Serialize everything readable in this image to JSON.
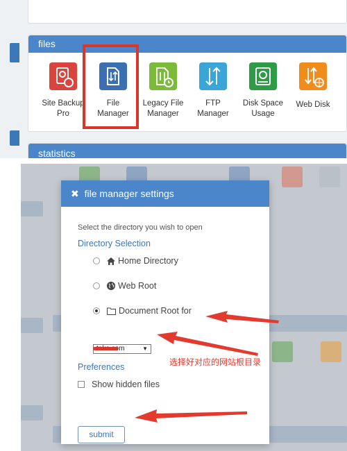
{
  "files_panel": {
    "title": "files",
    "apps": [
      {
        "label_1": "Site Backup",
        "label_2": "Pro",
        "icon": "site-backup-icon",
        "color": "#d9453e"
      },
      {
        "label_1": "File",
        "label_2": "Manager",
        "icon": "file-manager-icon",
        "color": "#3c6fb2"
      },
      {
        "label_1": "Legacy File",
        "label_2": "Manager",
        "icon": "legacy-file-manager-icon",
        "color": "#7cbb3a"
      },
      {
        "label_1": "FTP",
        "label_2": "Manager",
        "icon": "ftp-manager-icon",
        "color": "#3aa5d6"
      },
      {
        "label_1": "Disk Space",
        "label_2": "Usage",
        "icon": "disk-space-icon",
        "color": "#2e9b47"
      },
      {
        "label_1": "Web Disk",
        "label_2": "",
        "icon": "web-disk-icon",
        "color": "#ef8c1c"
      }
    ]
  },
  "stats_panel": {
    "title": "statistics"
  },
  "modal": {
    "title": "file manager settings",
    "prompt": "Select the directory you wish to open",
    "directory_section": "Directory Selection",
    "options": [
      {
        "label": "Home Directory",
        "icon": "home-icon",
        "checked": false
      },
      {
        "label": "Web Root",
        "icon": "globe-icon",
        "checked": false
      },
      {
        "label": "Document Root for",
        "icon": "folder-icon",
        "checked": true
      }
    ],
    "domain_value": "take.com",
    "preferences_section": "Preferences",
    "show_hidden_label": "Show hidden files",
    "submit_label": "submit"
  },
  "annotation": {
    "note": "选择好对应的网站根目录",
    "color": "#e23a2e"
  },
  "colors": {
    "panel_header": "#4a86c9",
    "highlight": "#d9362e"
  }
}
